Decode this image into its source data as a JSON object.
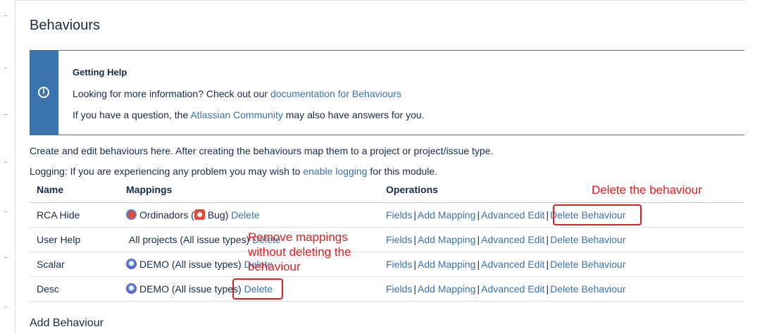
{
  "page": {
    "title": "Behaviours"
  },
  "info": {
    "heading": "Getting Help",
    "line1_prefix": "Looking for more information? Check out our ",
    "line1_link": "documentation for Behaviours",
    "line2_prefix": "If you have a question, the ",
    "line2_link": "Atlassian Community",
    "line2_suffix": " may also have answers for you."
  },
  "intro": "Create and edit behaviours here. After creating the behaviours map them to a project or project/issue type.",
  "logging": {
    "prefix": "Logging: If you are experiencing any problem you may wish to ",
    "link": "enable logging",
    "suffix": " for this module."
  },
  "table": {
    "headers": {
      "name": "Name",
      "mappings": "Mappings",
      "operations": "Operations"
    },
    "operations": {
      "fields": "Fields",
      "add_mapping": "Add Mapping",
      "advanced_edit": "Advanced Edit",
      "delete_behaviour": "Delete Behaviour",
      "separator": "|"
    },
    "rows": [
      {
        "name": "RCA Hide",
        "mapping_project": "Ordinadors (",
        "mapping_issue": "Bug)",
        "delete": "Delete"
      },
      {
        "name": "User Help",
        "mapping_text": "All projects (All issue types)",
        "delete": "Delete"
      },
      {
        "name": "Scalar",
        "mapping_text": "DEMO (All issue types)",
        "delete": "Delete"
      },
      {
        "name": "Desc",
        "mapping_text": "DEMO (All issue types)",
        "delete": "Delete"
      }
    ]
  },
  "add_behaviour": {
    "title": "Add Behaviour"
  },
  "annotations": {
    "delete_behaviour": "Delete the behaviour",
    "remove_mappings_line1": "Remove mappings",
    "remove_mappings_line2": "without deleting the",
    "remove_mappings_line3": "behaviour"
  },
  "colors": {
    "link": "#3b73af",
    "annotation": "#e02020",
    "info_stripe": "#3b73af"
  },
  "icons": {
    "info": "info-icon",
    "project_ordinadors": "project-ordinadors-icon",
    "issue_bug": "bug-icon",
    "project_demo": "project-demo-icon"
  }
}
